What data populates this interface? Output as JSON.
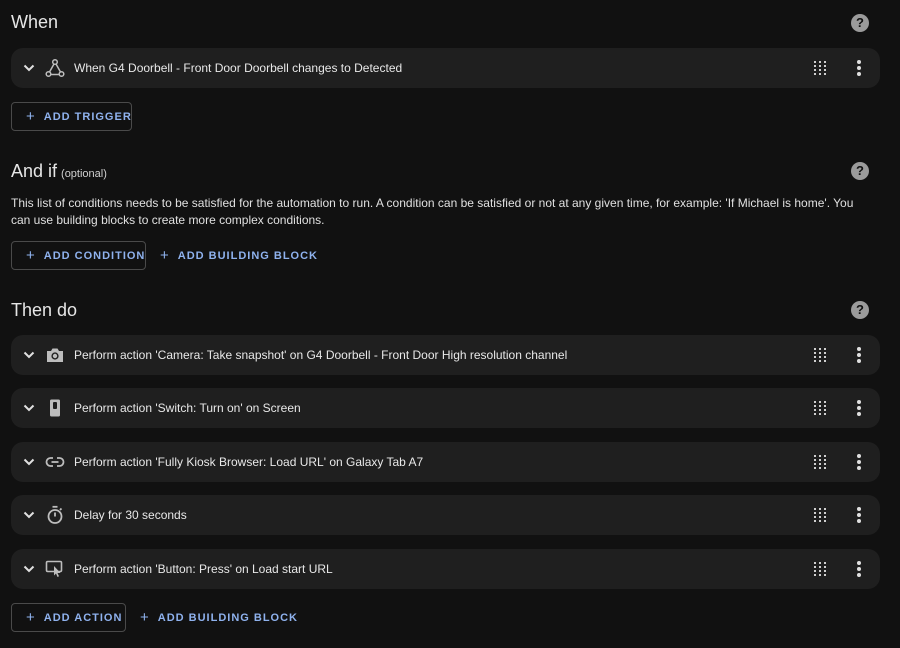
{
  "when": {
    "title": "When",
    "triggers": [
      {
        "icon": "trigger-icon",
        "label": "When G4 Doorbell - Front Door Doorbell changes to Detected"
      }
    ],
    "add_trigger": "ADD TRIGGER"
  },
  "and_if": {
    "title": "And if",
    "optional": "(optional)",
    "description": "This list of conditions needs to be satisfied for the automation to run. A condition can be satisfied or not at any given time, for example: 'If Michael is home'. You can use building blocks to create more complex conditions.",
    "add_condition": "ADD CONDITION",
    "add_building_block": "ADD BUILDING BLOCK"
  },
  "then_do": {
    "title": "Then do",
    "actions": [
      {
        "icon": "camera-icon",
        "label": "Perform action 'Camera: Take snapshot' on G4 Doorbell - Front Door High resolution channel"
      },
      {
        "icon": "switch-icon",
        "label": "Perform action 'Switch: Turn on' on Screen"
      },
      {
        "icon": "link-icon",
        "label": "Perform action 'Fully Kiosk Browser: Load URL' on Galaxy Tab A7"
      },
      {
        "icon": "timer-icon",
        "label": "Delay for 30 seconds"
      },
      {
        "icon": "button-press-icon",
        "label": "Perform action 'Button: Press' on Load start URL"
      }
    ],
    "add_action": "ADD ACTION",
    "add_building_block": "ADD BUILDING BLOCK"
  },
  "help_glyph": "?",
  "plus_glyph": "+"
}
